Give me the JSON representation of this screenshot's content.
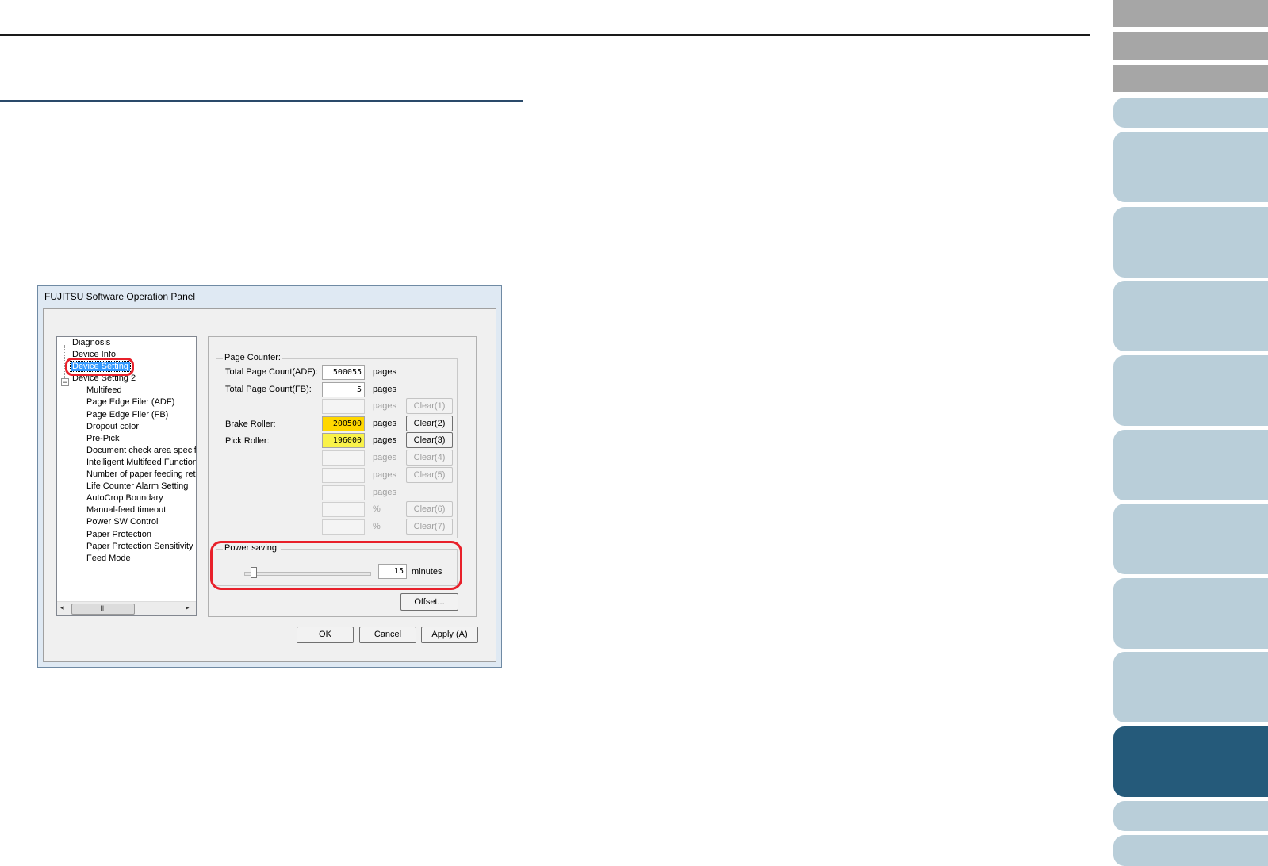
{
  "dialog": {
    "title": "FUJITSU Software Operation Panel"
  },
  "tree": {
    "items": [
      {
        "label": "Diagnosis"
      },
      {
        "label": "Device Info"
      },
      {
        "label": "Device Setting"
      },
      {
        "label": "Device Setting 2"
      },
      {
        "label": "Multifeed"
      },
      {
        "label": "Page Edge Filer (ADF)"
      },
      {
        "label": "Page Edge Filer (FB)"
      },
      {
        "label": "Dropout color"
      },
      {
        "label": "Pre-Pick"
      },
      {
        "label": "Document check area specific"
      },
      {
        "label": "Intelligent Multifeed Function"
      },
      {
        "label": "Number of paper feeding retries"
      },
      {
        "label": "Life Counter Alarm Setting"
      },
      {
        "label": "AutoCrop Boundary"
      },
      {
        "label": "Manual-feed timeout"
      },
      {
        "label": "Power SW Control"
      },
      {
        "label": "Paper Protection"
      },
      {
        "label": "Paper Protection Sensitivity"
      },
      {
        "label": "Feed Mode"
      }
    ],
    "selected": "Device Setting",
    "scroll_thumb": "III"
  },
  "page_counter": {
    "group_label": "Page Counter:",
    "rows": [
      {
        "label": "Total Page Count(ADF):",
        "value": "500055",
        "unit": "pages",
        "button": ""
      },
      {
        "label": "Total Page Count(FB):",
        "value": "5",
        "unit": "pages",
        "button": ""
      },
      {
        "label": "",
        "value": "",
        "unit": "pages",
        "button": "Clear(1)"
      },
      {
        "label": "Brake Roller:",
        "value": "200500",
        "unit": "pages",
        "button": "Clear(2)"
      },
      {
        "label": "Pick Roller:",
        "value": "196000",
        "unit": "pages",
        "button": "Clear(3)"
      },
      {
        "label": "",
        "value": "",
        "unit": "pages",
        "button": "Clear(4)"
      },
      {
        "label": "",
        "value": "",
        "unit": "pages",
        "button": "Clear(5)"
      },
      {
        "label": "",
        "value": "",
        "unit": "pages",
        "button": ""
      },
      {
        "label": "",
        "value": "",
        "unit": "%",
        "button": "Clear(6)"
      },
      {
        "label": "",
        "value": "",
        "unit": "%",
        "button": "Clear(7)"
      }
    ]
  },
  "power_saving": {
    "group_label": "Power saving:",
    "value": "15",
    "unit": "minutes"
  },
  "buttons": {
    "offset": "Offset...",
    "ok": "OK",
    "cancel": "Cancel",
    "apply": "Apply (A)"
  },
  "colors": {
    "highlight": "#e8202a",
    "nav_active": "#255a7a",
    "nav_inactive": "#b9ced9"
  }
}
